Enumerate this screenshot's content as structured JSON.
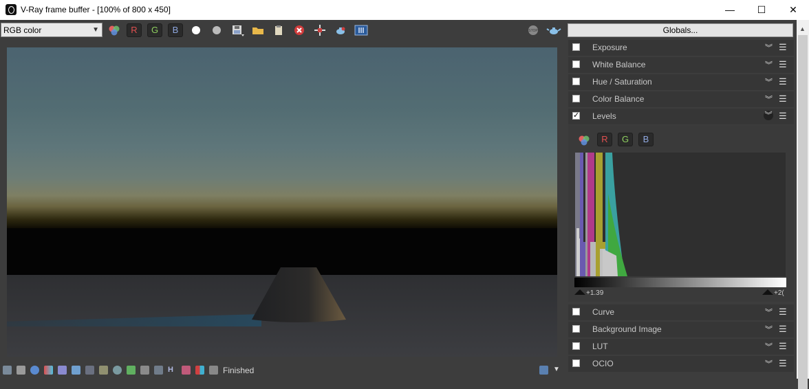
{
  "window": {
    "title": "V-Ray frame buffer - [100% of 800 x 450]",
    "minimize": "—",
    "maximize": "☐",
    "close": "✕"
  },
  "toolbar": {
    "channel_select": "RGB color",
    "r_label": "R",
    "g_label": "G",
    "b_label": "B"
  },
  "status": {
    "text": "Finished"
  },
  "panel": {
    "globals_label": "Globals...",
    "layers": [
      {
        "label": "Exposure",
        "checked": false
      },
      {
        "label": "White Balance",
        "checked": false
      },
      {
        "label": "Hue / Saturation",
        "checked": false
      },
      {
        "label": "Color Balance",
        "checked": false
      },
      {
        "label": "Levels",
        "checked": true
      },
      {
        "label": "Curve",
        "checked": false
      },
      {
        "label": "Background Image",
        "checked": false
      },
      {
        "label": "LUT",
        "checked": false
      },
      {
        "label": "OCIO",
        "checked": false
      }
    ],
    "levels": {
      "r_label": "R",
      "g_label": "G",
      "b_label": "B",
      "low_value": "+1.39",
      "high_value": "+2("
    }
  },
  "colors": {
    "r": "#e05050",
    "g": "#8fd060",
    "b": "#8fa8e0",
    "accent": "#4b6370"
  }
}
